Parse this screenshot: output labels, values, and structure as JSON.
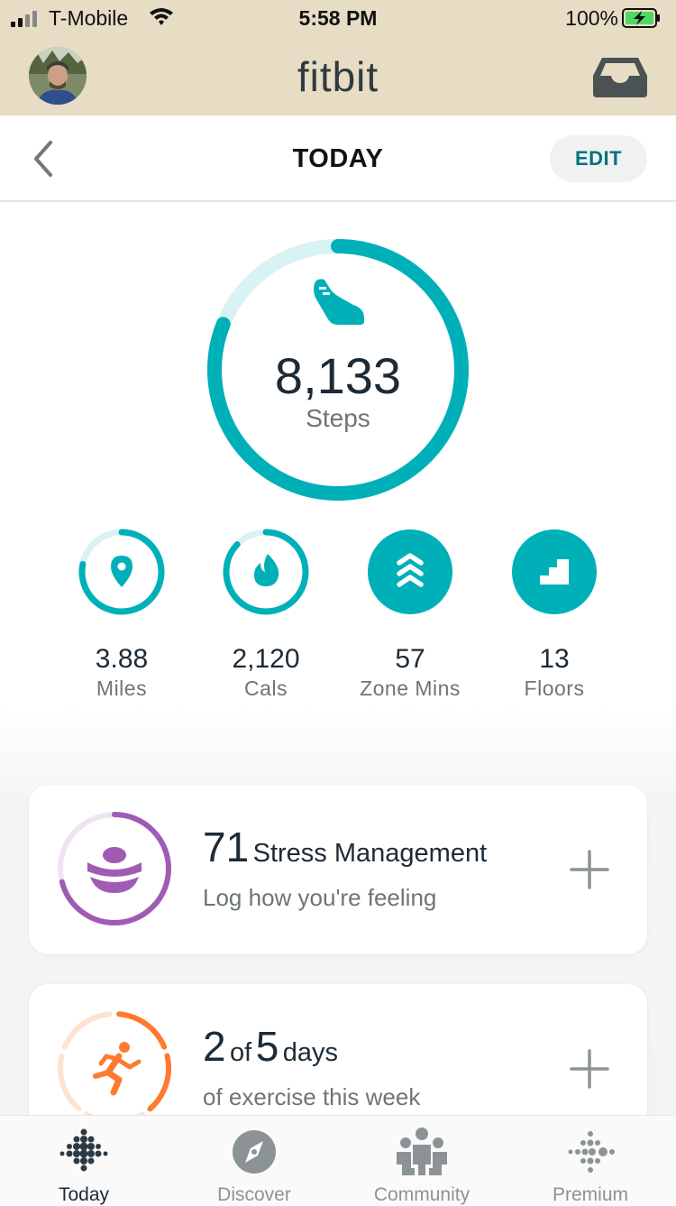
{
  "status_bar": {
    "carrier": "T-Mobile",
    "time": "5:58 PM",
    "battery_percent": "100%"
  },
  "header": {
    "logo": "fitbit",
    "inbox_icon": "inbox-icon"
  },
  "nav": {
    "title": "TODAY",
    "edit_label": "EDIT",
    "back_icon": "chevron-left-icon"
  },
  "colors": {
    "accent": "#00b0b9",
    "accent_light": "#d9f2f3",
    "stress": "#a05bb4",
    "exercise": "#ff7a2f",
    "header_bg": "#e7dcc4"
  },
  "steps": {
    "value": "8,133",
    "label": "Steps",
    "goal_progress": 0.81,
    "icon": "shoe-icon"
  },
  "stats": [
    {
      "value": "3.88",
      "label": "Miles",
      "icon": "location-pin-icon",
      "progress": 0.78
    },
    {
      "value": "2,120",
      "label": "Cals",
      "icon": "flame-icon",
      "progress": 0.87
    },
    {
      "value": "57",
      "label": "Zone Mins",
      "icon": "zone-chevrons-icon",
      "progress": 1.0
    },
    {
      "value": "13",
      "label": "Floors",
      "icon": "stairs-icon",
      "progress": 1.0
    }
  ],
  "cards": {
    "stress": {
      "score": "71",
      "title": "Stress Management",
      "subtitle": "Log how you're feeling",
      "progress": 0.71,
      "icon": "stress-meditation-icon"
    },
    "exercise": {
      "count": "2",
      "of_text": "of",
      "goal": "5",
      "unit": "days",
      "subtitle": "of exercise this week",
      "done": 2,
      "total": 5,
      "icon": "runner-icon"
    }
  },
  "tabs": [
    {
      "label": "Today",
      "icon": "fitbit-dots-icon",
      "active": true
    },
    {
      "label": "Discover",
      "icon": "compass-icon",
      "active": false
    },
    {
      "label": "Community",
      "icon": "community-icon",
      "active": false
    },
    {
      "label": "Premium",
      "icon": "premium-dots-icon",
      "active": false
    }
  ]
}
